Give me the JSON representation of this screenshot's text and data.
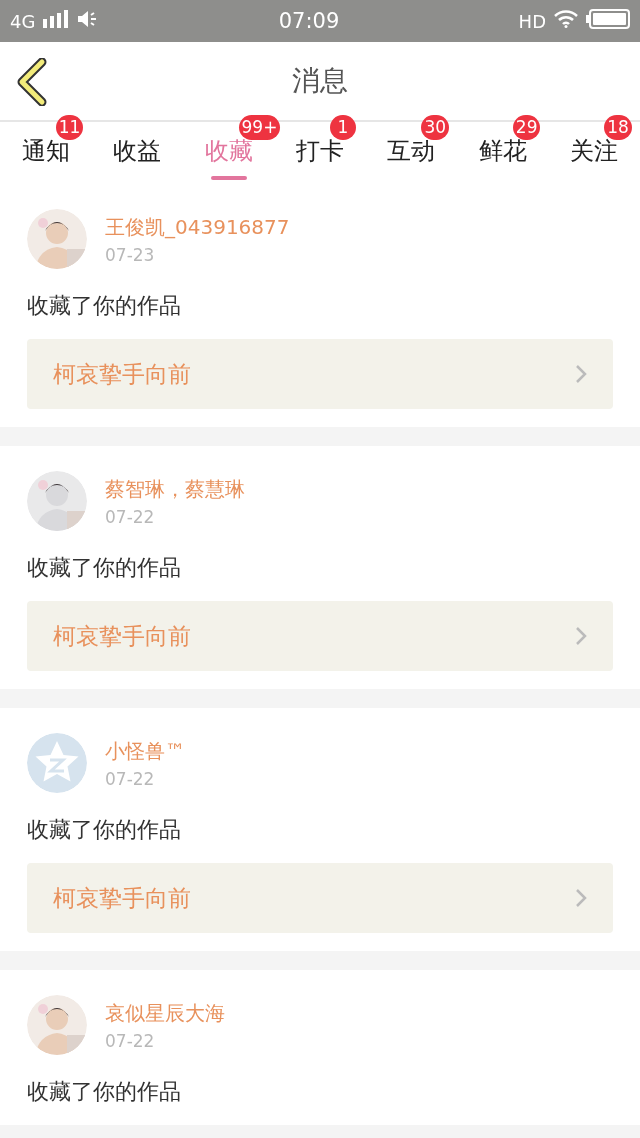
{
  "status_bar": {
    "network": "4G",
    "time": "07:09",
    "hd": "HD"
  },
  "header": {
    "title": "消息"
  },
  "tabs": [
    {
      "label": "通知",
      "badge": "11",
      "selected": false
    },
    {
      "label": "收益",
      "selected": false
    },
    {
      "label": "收藏",
      "badge": "99+",
      "selected": true
    },
    {
      "label": "打卡",
      "badge": "1",
      "selected": false
    },
    {
      "label": "互动",
      "badge": "30",
      "selected": false
    },
    {
      "label": "鲜花",
      "badge": "29",
      "selected": false
    },
    {
      "label": "关注",
      "badge": "18",
      "selected": false
    }
  ],
  "messages": [
    {
      "name": "王俊凯_043916877",
      "date": "07-23",
      "text": "收藏了你的作品",
      "work": "柯哀挚手向前"
    },
    {
      "name": "蔡智琳，蔡慧琳",
      "date": "07-22",
      "text": "收藏了你的作品",
      "work": "柯哀挚手向前"
    },
    {
      "avatar": {
        "kind": "default"
      },
      "name": "小怪兽™",
      "date": "07-22",
      "text": "收藏了你的作品",
      "work": "柯哀挚手向前"
    },
    {
      "name": "哀似星辰大海",
      "date": "07-22",
      "text": "收藏了你的作品"
    }
  ]
}
